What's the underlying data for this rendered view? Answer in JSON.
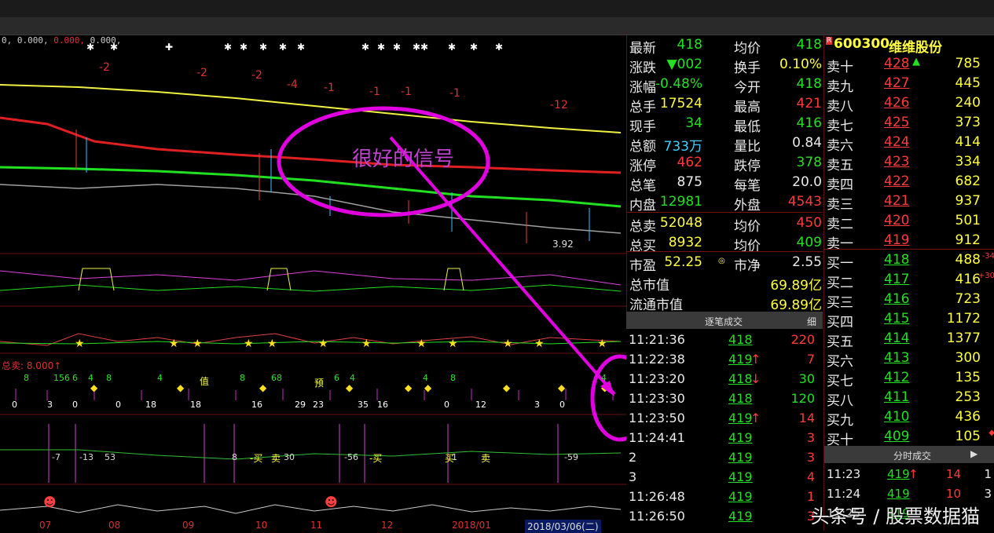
{
  "index_header": {
    "part1": "0, 0.000, ",
    "part2": "0.000, ",
    "part3": "0.000,"
  },
  "annotation": {
    "text": "很好的信号"
  },
  "chart_labels": {
    "ma_nums": [
      "-2",
      "-2",
      "-2",
      "-4",
      "-1",
      "-1",
      "-1",
      "-1",
      "-12"
    ],
    "low_label": "3.92",
    "sell_label": "总卖: 8.000↑",
    "marks_bottom": [
      "0",
      "3",
      "0",
      "0",
      "18",
      "18",
      "16",
      "29",
      "23",
      "35",
      "16",
      "0",
      "12",
      "3",
      "0"
    ],
    "marks_top": [
      "8",
      "156",
      "6",
      "4",
      "8",
      "4",
      "8",
      "68",
      "6",
      "4",
      "4",
      "8",
      "4"
    ],
    "kw_top_left": "值",
    "kw_mid": "预",
    "panel4_nums": [
      "-7",
      "-13",
      "53",
      "8",
      "30",
      "-56",
      "1",
      "-59"
    ],
    "panel4_words": [
      "-买",
      "卖",
      "-买",
      "买",
      "卖"
    ],
    "dates": [
      "07",
      "08",
      "09",
      "10",
      "11",
      "12",
      "2018/01"
    ],
    "date_box": "2018/03/06(二)"
  },
  "quote": {
    "rows": [
      {
        "l1": "最新",
        "v1": "418",
        "c1": "grn",
        "l2": "均价",
        "v2": "418",
        "c2": "grn"
      },
      {
        "l1": "涨跌",
        "v1": "▼002",
        "c1": "grn",
        "l2": "换手",
        "v2": "0.10%",
        "c2": "yel"
      },
      {
        "l1": "涨幅",
        "v1": "-0.48%",
        "c1": "grn",
        "l2": "今开",
        "v2": "418",
        "c2": "grn"
      },
      {
        "l1": "总手",
        "v1": "17524",
        "c1": "yel",
        "l2": "最高",
        "v2": "421",
        "c2": "red"
      },
      {
        "l1": "现手",
        "v1": "34",
        "c1": "grn",
        "l2": "最低",
        "v2": "416",
        "c2": "grn"
      },
      {
        "l1": "总额",
        "v1": "733万",
        "c1": "cyan",
        "l2": "量比",
        "v2": "0.84",
        "c2": "wht"
      },
      {
        "l1": "涨停",
        "v1": "462",
        "c1": "red",
        "l2": "跌停",
        "v2": "378",
        "c2": "grn"
      },
      {
        "l1": "总笔",
        "v1": "875",
        "c1": "wht",
        "l2": "每笔",
        "v2": "20.0",
        "c2": "wht"
      },
      {
        "l1": "内盘",
        "v1": "12981",
        "c1": "grn",
        "l2": "外盘",
        "v2": "4543",
        "c2": "red"
      },
      {
        "l1": "总卖",
        "v1": "52048",
        "c1": "yel",
        "l2": "均价",
        "v2": "450",
        "c2": "red"
      },
      {
        "l1": "总买",
        "v1": "8932",
        "c1": "yel",
        "l2": "均价",
        "v2": "409",
        "c2": "grn"
      },
      {
        "l1": "市盈",
        "v1": "52.25",
        "c1": "yel",
        "l2": "市净",
        "v2": "2.55",
        "c2": "wht"
      }
    ],
    "mktcap": {
      "label": "总市值",
      "value": "69.89亿"
    },
    "float_mktcap": {
      "label": "流通市值",
      "value": "69.89亿"
    },
    "pe_mark": "◎"
  },
  "ticks": {
    "header": "逐笔成交",
    "detail_btn": "细",
    "rows": [
      {
        "t": "11:21:36",
        "p": "418",
        "pc": "grn",
        "arr": "",
        "v": "220",
        "vc": "red"
      },
      {
        "t": "11:22:38",
        "p": "419",
        "pc": "grn",
        "arr": "↑",
        "v": "7",
        "vc": "red"
      },
      {
        "t": "11:23:20",
        "p": "418",
        "pc": "grn",
        "arr": "↓",
        "v": "30",
        "vc": "grn"
      },
      {
        "t": "11:23:30",
        "p": "418",
        "pc": "grn",
        "arr": "",
        "v": "120",
        "vc": "grn"
      },
      {
        "t": "11:23:50",
        "p": "419",
        "pc": "grn",
        "arr": "↑",
        "v": "14",
        "vc": "red"
      },
      {
        "t": "11:24:41",
        "p": "419",
        "pc": "grn",
        "arr": "",
        "v": "3",
        "vc": "red"
      },
      {
        "t": "2",
        "p": "419",
        "pc": "grn",
        "arr": "",
        "v": "3",
        "vc": "red"
      },
      {
        "t": "3",
        "p": "419",
        "pc": "grn",
        "arr": "",
        "v": "4",
        "vc": "red"
      },
      {
        "t": "11:26:48",
        "p": "419",
        "pc": "grn",
        "arr": "",
        "v": "1",
        "vc": "red"
      },
      {
        "t": "11:26:50",
        "p": "419",
        "pc": "grn",
        "arr": "",
        "v": "3",
        "vc": "red"
      }
    ]
  },
  "book": {
    "badge": "R",
    "code": "600300",
    "name": "维维股份",
    "asks": [
      {
        "l": "卖十",
        "p": "428",
        "v": "785",
        "mark": "▲"
      },
      {
        "l": "卖九",
        "p": "427",
        "v": "445",
        "mark": ""
      },
      {
        "l": "卖八",
        "p": "426",
        "v": "240",
        "mark": ""
      },
      {
        "l": "卖七",
        "p": "425",
        "v": "373",
        "mark": ""
      },
      {
        "l": "卖六",
        "p": "424",
        "v": "414",
        "mark": ""
      },
      {
        "l": "卖五",
        "p": "423",
        "v": "334",
        "mark": ""
      },
      {
        "l": "卖四",
        "p": "422",
        "v": "682",
        "mark": ""
      },
      {
        "l": "卖三",
        "p": "421",
        "v": "937",
        "mark": ""
      },
      {
        "l": "卖二",
        "p": "420",
        "v": "501",
        "mark": ""
      },
      {
        "l": "卖一",
        "p": "419",
        "v": "912",
        "mark": ""
      }
    ],
    "bids": [
      {
        "l": "买一",
        "p": "418",
        "v": "488",
        "side": "-34"
      },
      {
        "l": "买二",
        "p": "417",
        "v": "416",
        "side": "+30"
      },
      {
        "l": "买三",
        "p": "416",
        "v": "723",
        "side": ""
      },
      {
        "l": "买四",
        "p": "415",
        "v": "1172",
        "side": ""
      },
      {
        "l": "买五",
        "p": "414",
        "v": "1377",
        "side": ""
      },
      {
        "l": "买六",
        "p": "413",
        "v": "300",
        "side": ""
      },
      {
        "l": "买七",
        "p": "412",
        "v": "135",
        "side": ""
      },
      {
        "l": "买八",
        "p": "411",
        "v": "253",
        "side": ""
      },
      {
        "l": "买九",
        "p": "410",
        "v": "436",
        "side": ""
      },
      {
        "l": "买十",
        "p": "409",
        "v": "105",
        "side": "◆"
      }
    ],
    "fs_header": "分时成交",
    "fs_btn": "▶",
    "fs_rows": [
      {
        "t": "11:23",
        "p": "419",
        "arr": "↑",
        "v": "14",
        "n": "1"
      },
      {
        "t": "11:24",
        "p": "419",
        "arr": "",
        "v": "10",
        "n": "3"
      },
      {
        "t": "11:25",
        "p": "419",
        "arr": "",
        "v": "",
        "n": ""
      }
    ]
  },
  "watermark": {
    "text": "头条号 / 股票数据猫"
  },
  "colors": {
    "up": "#ff3a3a",
    "down": "#22e022",
    "accent": "#ffff40",
    "annotation": "#e000e0"
  }
}
